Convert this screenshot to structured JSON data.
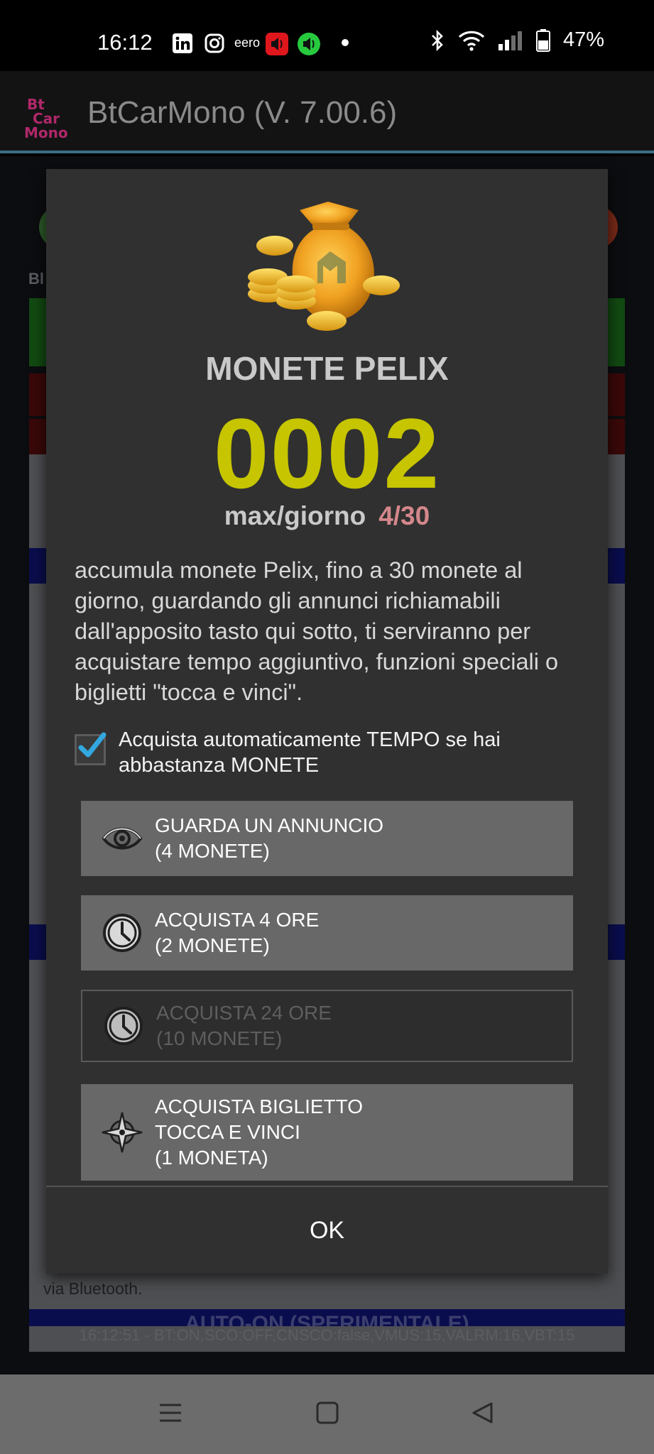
{
  "status_bar": {
    "time": "16:12",
    "icons_left": [
      "linkedin-icon",
      "instagram-icon",
      "eero-icon",
      "red-speaker-icon",
      "green-speaker-icon",
      "dot-icon"
    ],
    "eero_text": "eero",
    "icons_right": [
      "bluetooth-icon",
      "wifi-icon",
      "signal-icon",
      "battery-icon"
    ],
    "battery": "47%"
  },
  "app_bar": {
    "logo_text": "BtCarMono",
    "title": "BtCarMono (V. 7.00.6)"
  },
  "background": {
    "partial_text_bottom": "via Bluetooth.",
    "partial_banner": "AUTO-ON (SPERIMENTALE)",
    "status_line": "16:12:51 - BT:ON,SCO:OFF,CNSCO:false,VMUS:15,VALRM:16,VBT:15",
    "label_bl": "Bl"
  },
  "dialog": {
    "title": "MONETE PELIX",
    "coin_count": "0002",
    "max_label": "max/giorno",
    "max_value": "4/30",
    "description": "accumula monete Pelix, fino a 30 monete al giorno, guardando gli annunci richiamabili dall'apposito tasto qui sotto, ti serviranno per acquistare tempo aggiuntivo, funzioni speciali o biglietti \"tocca e vinci\".",
    "auto_buy": {
      "checked": true,
      "label_line1": "Acquista automaticamente TEMPO se hai",
      "label_line2": "abbastanza MONETE"
    },
    "buttons": [
      {
        "icon": "eye-icon",
        "line1": "GUARDA UN ANNUNCIO",
        "line2": "(4 MONETE)",
        "line3": "",
        "enabled": true
      },
      {
        "icon": "clock-icon",
        "line1": "ACQUISTA 4 ORE",
        "line2": "(2 MONETE)",
        "line3": "",
        "enabled": true
      },
      {
        "icon": "clock-icon",
        "line1": "ACQUISTA 24 ORE",
        "line2": "(10 MONETE)",
        "line3": "",
        "enabled": false
      },
      {
        "icon": "compass-icon",
        "line1": "ACQUISTA BIGLIETTO",
        "line2": "TOCCA E VINCI",
        "line3": "(1 MONETA)",
        "enabled": true
      }
    ],
    "ok_label": "OK"
  },
  "colors": {
    "accent_yellow": "#c6c500",
    "max_value_pink": "#d4878b",
    "checkbox_blue": "#33a8e0",
    "dialog_bg": "#303030",
    "button_bg": "#686868"
  },
  "nav_bar": {
    "icons": [
      "menu-icon",
      "home-square-icon",
      "back-triangle-icon"
    ]
  }
}
